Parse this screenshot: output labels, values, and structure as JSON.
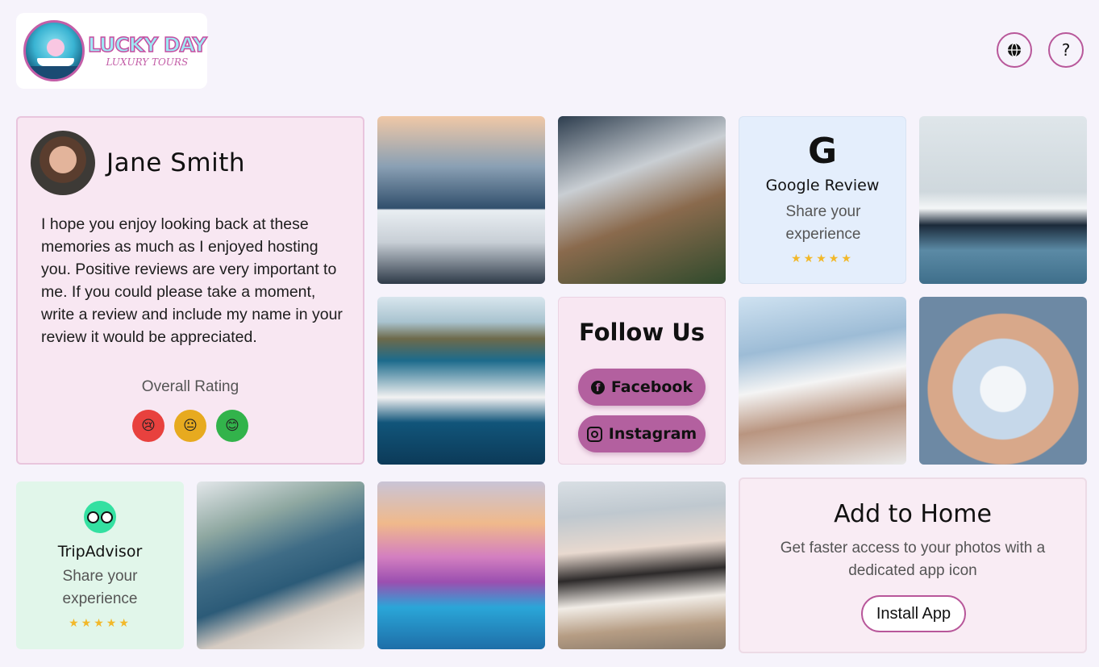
{
  "brand": {
    "title": "LUCKY DAY",
    "subtitle": "LUXURY TOURS"
  },
  "header": {
    "help_label": "?"
  },
  "host": {
    "name": "Jane Smith",
    "message": "I hope you enjoy looking back at these memories as much as I enjoyed hosting you. Positive reviews are very important to me. If you could please take a moment, write a review and include my name in your review it would be appreciated.",
    "rating_label": "Overall Rating",
    "ratings": [
      {
        "name": "sad",
        "glyph": "😢",
        "color": "#e8413e"
      },
      {
        "name": "neutral",
        "glyph": "😐",
        "color": "#e7aa1f"
      },
      {
        "name": "happy",
        "glyph": "😊",
        "color": "#32b34b"
      }
    ]
  },
  "google": {
    "icon": "G",
    "title": "Google Review",
    "subtitle": "Share your experience",
    "stars": "★★★★★"
  },
  "social": {
    "title": "Follow Us",
    "facebook": "Facebook",
    "instagram": "Instagram",
    "facebook_icon": "f"
  },
  "tripadvisor": {
    "title": "TripAdvisor",
    "subtitle": "Share your experience",
    "stars": "★★★★★"
  },
  "install": {
    "title": "Add to Home",
    "description": "Get faster access to your photos with a dedicated app icon",
    "button": "Install App"
  },
  "colors": {
    "accent": "#b8579a",
    "background": "#f6f3fb",
    "star": "#f2b829"
  }
}
